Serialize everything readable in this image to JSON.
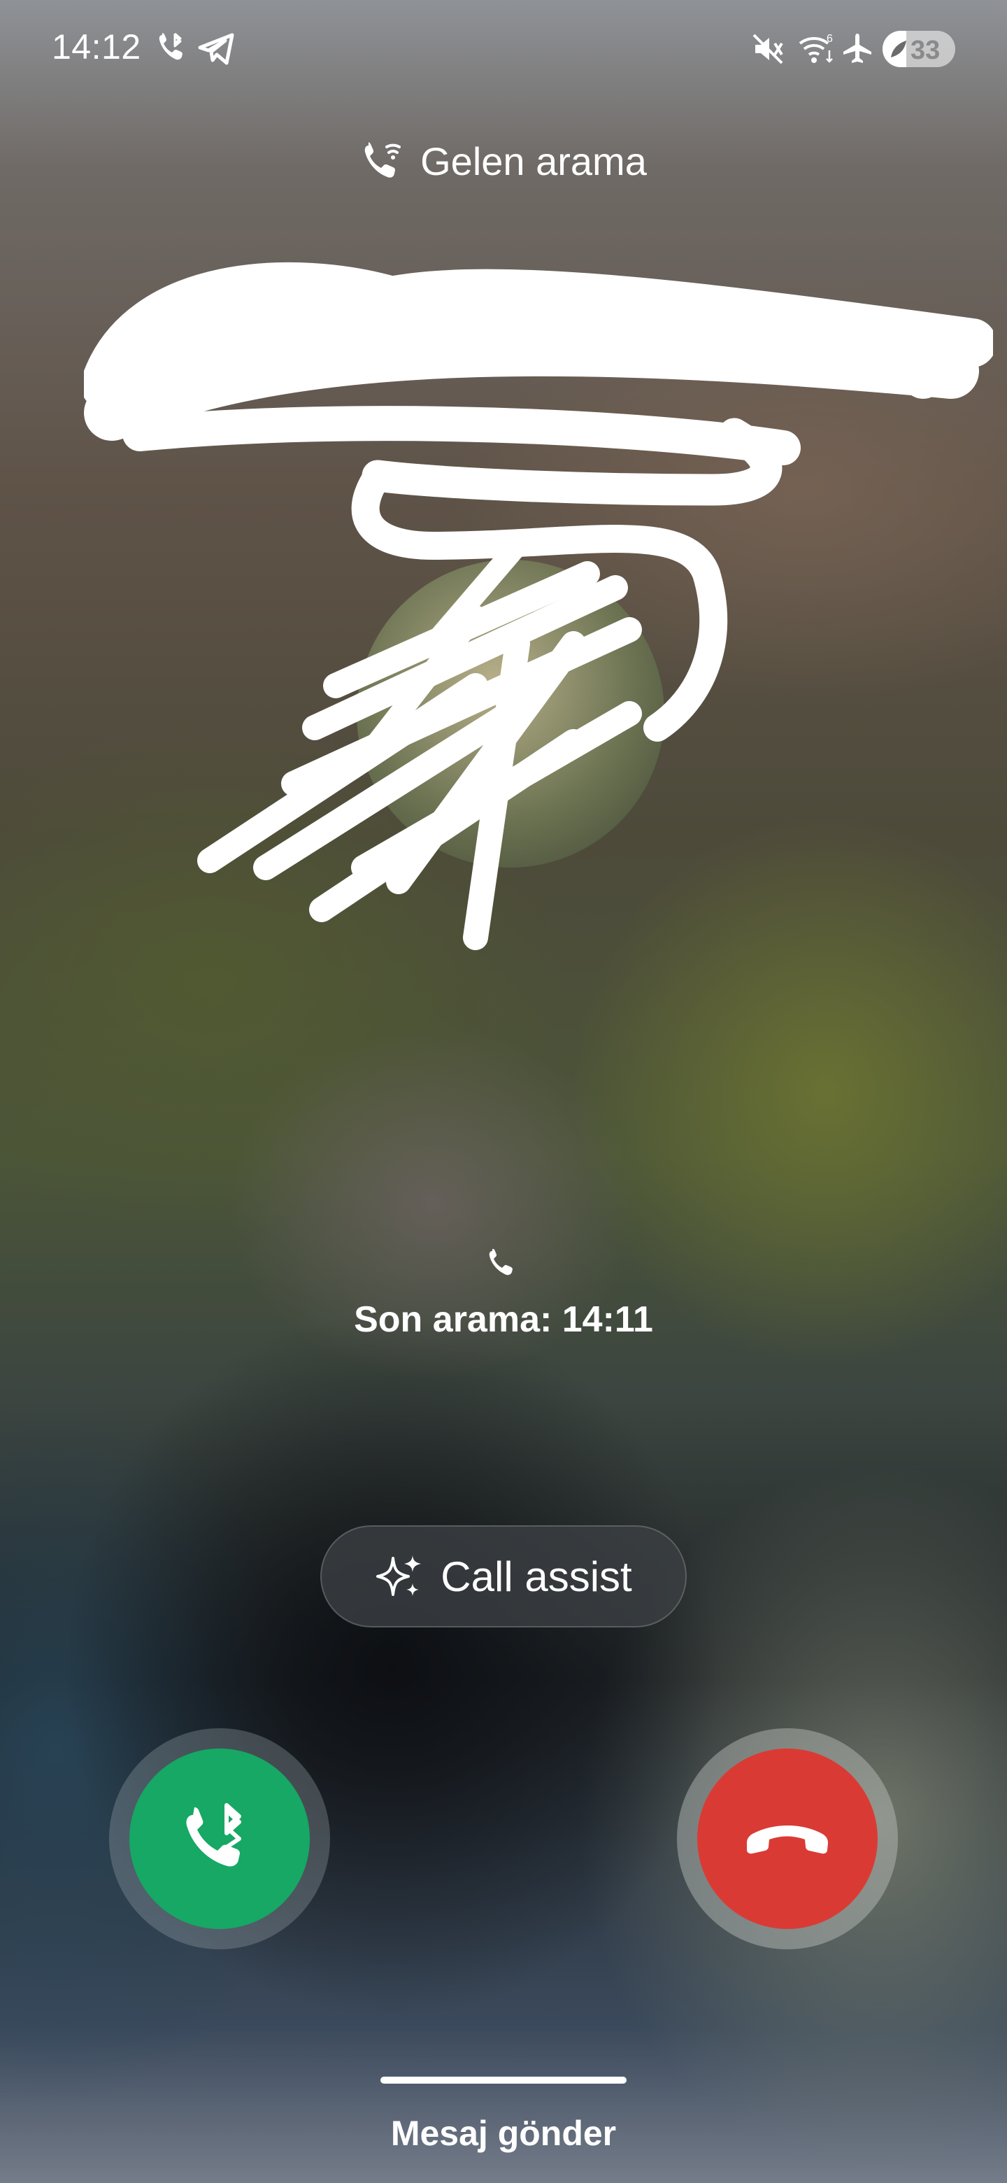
{
  "status_bar": {
    "time": "14:12",
    "battery_level": "33",
    "icons": [
      "bluetooth-call-icon",
      "telegram-icon",
      "mute-icon",
      "wifi-calling-icon",
      "airplane-icon",
      "battery-icon"
    ]
  },
  "header": {
    "label": "Gelen arama",
    "icon": "wifi-call-icon"
  },
  "caller": {
    "name": "",
    "location": "",
    "redacted": true
  },
  "last_call": {
    "icon": "phone-icon",
    "text": "Son arama: 14:11"
  },
  "call_assist": {
    "label": "Call assist",
    "icon": "sparkle-icon"
  },
  "actions": {
    "answer": {
      "icon": "bluetooth-phone-icon",
      "color": "#16a864"
    },
    "decline": {
      "icon": "hang-up-icon",
      "color": "#d93b34"
    }
  },
  "bottom": {
    "send_message_label": "Mesaj gönder"
  }
}
